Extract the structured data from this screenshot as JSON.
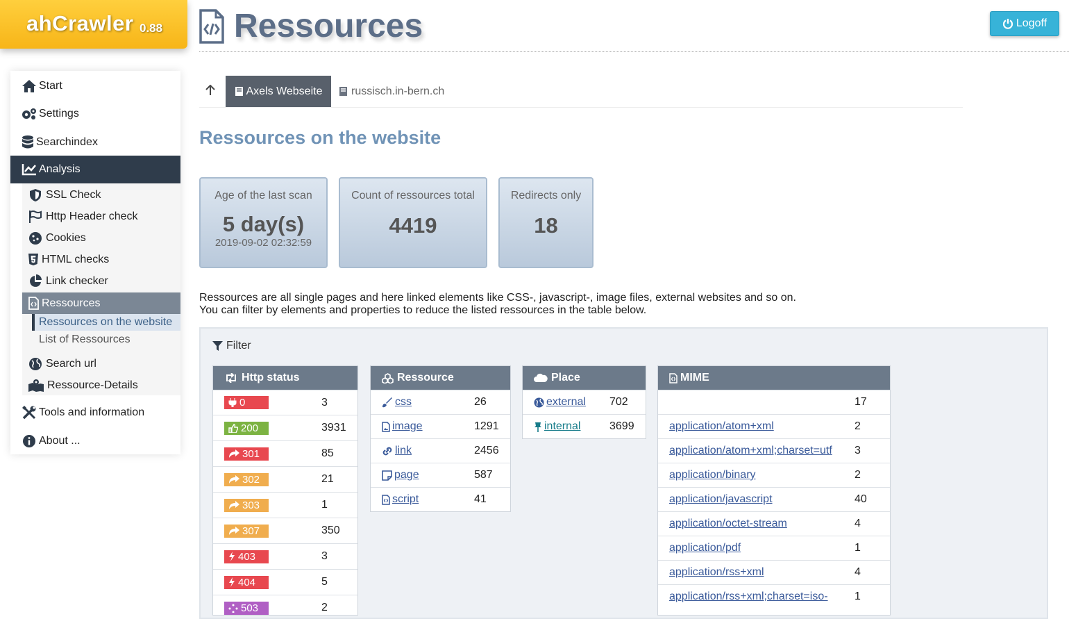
{
  "app": {
    "name": "ahCrawler",
    "version": "0.88"
  },
  "header": {
    "title": "Ressources",
    "logoff_label": "Logoff"
  },
  "sidebar": {
    "items": [
      {
        "label": "Start"
      },
      {
        "label": "Settings"
      },
      {
        "label": "Searchindex"
      },
      {
        "label": "Analysis"
      },
      {
        "label": "Tools and information"
      },
      {
        "label": "About ..."
      }
    ],
    "analysis_sub": [
      {
        "label": "SSL Check"
      },
      {
        "label": "Http Header check"
      },
      {
        "label": "Cookies"
      },
      {
        "label": "HTML checks"
      },
      {
        "label": "Link checker"
      },
      {
        "label": "Ressources"
      },
      {
        "label": "Search url"
      },
      {
        "label": "Ressource-Details"
      }
    ],
    "ressources_sub": [
      {
        "label": "Ressources on the website"
      },
      {
        "label": "List of Ressources"
      }
    ]
  },
  "tabs": [
    {
      "label": "Axels Webseite"
    },
    {
      "label": "russisch.in-bern.ch"
    }
  ],
  "section_title": "Ressources on the website",
  "stats": [
    {
      "label": "Age of the last scan",
      "value": "5 day(s)",
      "sub": "2019-09-02 02:32:59"
    },
    {
      "label": "Count of ressources total",
      "value": "4419"
    },
    {
      "label": "Redirects only",
      "value": "18"
    }
  ],
  "intro": {
    "line1": "Ressources are all single pages and here linked elements like CSS-, javascript-, image files, external websites and so on.",
    "line2": "You can filter by elements and properties to reduce the listed ressources in the table below."
  },
  "filter": {
    "title": "Filter",
    "http_status": {
      "header": "Http status",
      "rows": [
        {
          "code": "0",
          "count": "3",
          "color": "#e8484f"
        },
        {
          "code": "200",
          "count": "3931",
          "color": "#7cb342"
        },
        {
          "code": "301",
          "count": "85",
          "color": "#e8484f"
        },
        {
          "code": "302",
          "count": "21",
          "color": "#f0ad4e"
        },
        {
          "code": "303",
          "count": "1",
          "color": "#f0ad4e"
        },
        {
          "code": "307",
          "count": "350",
          "color": "#f0ad4e"
        },
        {
          "code": "403",
          "count": "3",
          "color": "#e8484f"
        },
        {
          "code": "404",
          "count": "5",
          "color": "#e8484f"
        },
        {
          "code": "503",
          "count": "2",
          "color": "#b05fc4"
        }
      ]
    },
    "ressource": {
      "header": "Ressource",
      "rows": [
        {
          "type": "css",
          "count": "26"
        },
        {
          "type": "image",
          "count": "1291"
        },
        {
          "type": "link",
          "count": "2456"
        },
        {
          "type": "page",
          "count": "587"
        },
        {
          "type": "script",
          "count": "41"
        }
      ]
    },
    "place": {
      "header": "Place",
      "rows": [
        {
          "type": "external",
          "count": "702"
        },
        {
          "type": "internal",
          "count": "3699"
        }
      ]
    },
    "mime": {
      "header": "MIME",
      "rows": [
        {
          "type": "",
          "count": "17"
        },
        {
          "type": "application/atom+xml",
          "count": "2"
        },
        {
          "type": "application/atom+xml;charset=utf",
          "count": "3"
        },
        {
          "type": "application/binary",
          "count": "2"
        },
        {
          "type": "application/javascript",
          "count": "40"
        },
        {
          "type": "application/octet-stream",
          "count": "4"
        },
        {
          "type": "application/pdf",
          "count": "1"
        },
        {
          "type": "application/rss+xml",
          "count": "4"
        },
        {
          "type": "application/rss+xml;charset=iso-",
          "count": "1"
        }
      ]
    }
  }
}
